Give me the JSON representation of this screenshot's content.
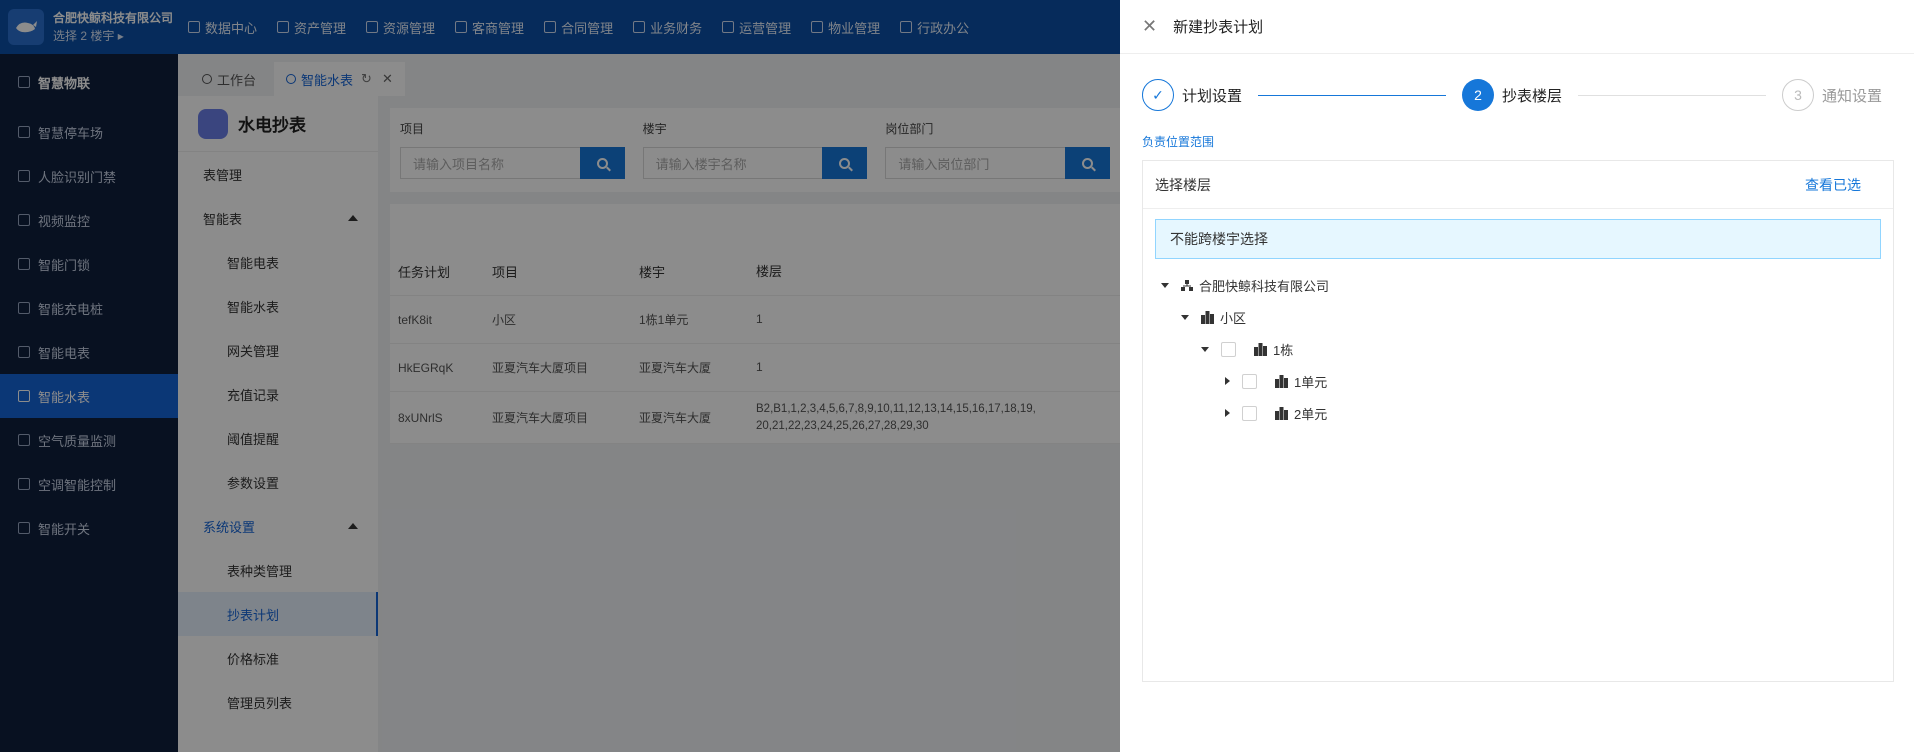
{
  "company": {
    "name": "合肥快鲸科技有限公司",
    "building_selector": "选择 2 楼宇"
  },
  "top_nav": [
    "数据中心",
    "资产管理",
    "资源管理",
    "客商管理",
    "合同管理",
    "业务财务",
    "运营管理",
    "物业管理",
    "行政办公"
  ],
  "sidebar": {
    "items": [
      "智慧物联",
      "智慧停车场",
      "人脸识别门禁",
      "视频监控",
      "智能门锁",
      "智能充电桩",
      "智能电表",
      "智能水表",
      "空气质量监测",
      "空调智能控制",
      "智能开关"
    ],
    "active": "智能水表"
  },
  "tabs": [
    {
      "label": "工作台"
    },
    {
      "label": "智能水表"
    }
  ],
  "submenu": {
    "title": "水电抄表",
    "items": [
      "表管理",
      "智能表",
      "智能电表",
      "智能水表",
      "网关管理",
      "充值记录",
      "阈值提醒",
      "参数设置",
      "系统设置",
      "表种类管理",
      "抄表计划",
      "价格标准",
      "管理员列表"
    ]
  },
  "filters": [
    {
      "label": "项目",
      "placeholder": "请输入项目名称"
    },
    {
      "label": "楼宇",
      "placeholder": "请输入楼宇名称"
    },
    {
      "label": "岗位部门",
      "placeholder": "请输入岗位部门"
    }
  ],
  "table": {
    "headers": [
      "任务计划",
      "项目",
      "楼宇",
      "楼层"
    ],
    "rows": [
      [
        "tefK8it",
        "小区",
        "1栋1单元",
        "1"
      ],
      [
        "HkEGRqK",
        "亚夏汽车大厦项目",
        "亚夏汽车大厦",
        "1"
      ],
      [
        "8xUNrlS",
        "亚夏汽车大厦项目",
        "亚夏汽车大厦",
        "B2,B1,1,2,3,4,5,6,7,8,9,10,11,12,13,14,15,16,17,18,19,\n20,21,22,23,24,25,26,27,28,29,30"
      ]
    ]
  },
  "drawer": {
    "title": "新建抄表计划",
    "steps": [
      {
        "number": "✓",
        "label": "计划设置"
      },
      {
        "number": "2",
        "label": "抄表楼层"
      },
      {
        "number": "3",
        "label": "通知设置"
      }
    ],
    "scope_label": "负责位置范围",
    "panel_title": "选择楼层",
    "view_selected": "查看已选",
    "notice": "不能跨楼宇选择",
    "tree": {
      "root": "合肥快鲸科技有限公司",
      "project": "小区",
      "building": "1栋",
      "units": [
        "1单元",
        "2单元"
      ]
    }
  },
  "colors": {
    "primary": "#1677d9",
    "topbar": "#0b4fa6",
    "sidebar": "#0f1f3d",
    "active_side": "#1565d8"
  }
}
